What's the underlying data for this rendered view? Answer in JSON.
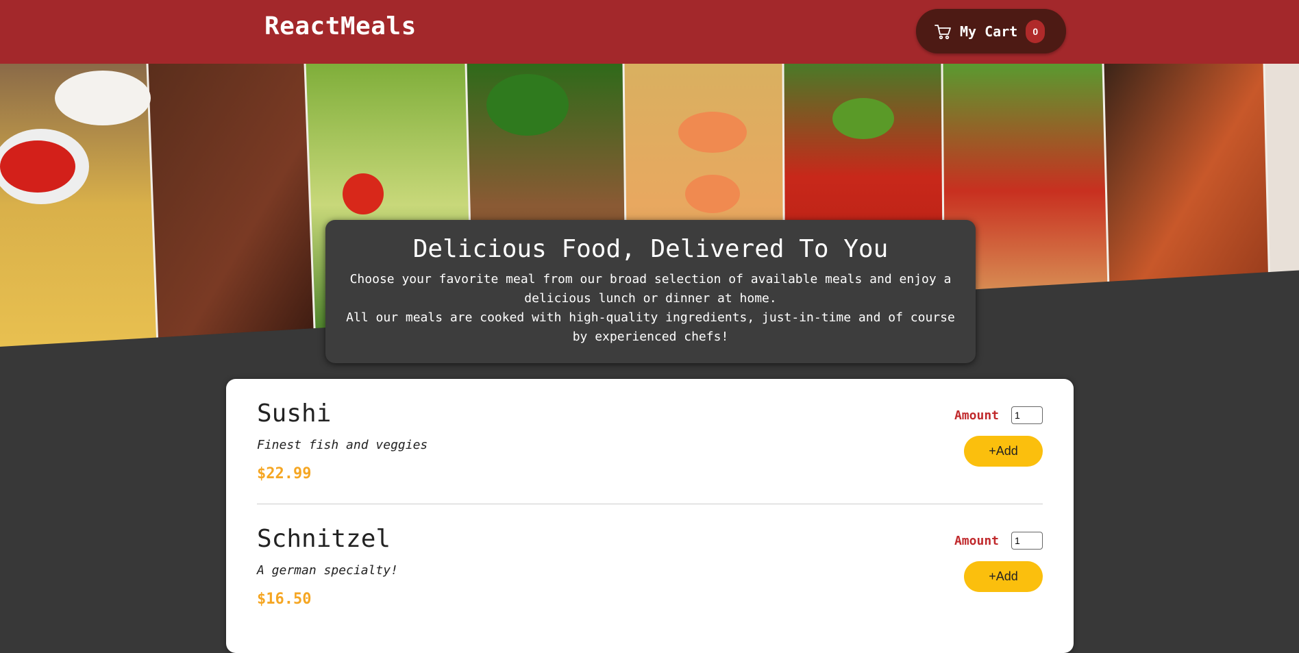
{
  "header": {
    "logo": "ReactMeals",
    "cart_label": "My Cart",
    "cart_count": "0",
    "cart_icon": "cart-icon"
  },
  "summary": {
    "title": "Delicious Food, Delivered To You",
    "paragraph1": "Choose your favorite meal from our broad selection of available meals and enjoy a delicious lunch or dinner at home.",
    "paragraph2": "All our meals are cooked with high-quality ingredients, just-in-time and of course by experienced chefs!"
  },
  "meals": [
    {
      "name": "Sushi",
      "description": "Finest fish and veggies",
      "price": "$22.99",
      "amount_label": "Amount",
      "amount_value": "1",
      "add_label": "+Add"
    },
    {
      "name": "Schnitzel",
      "description": "A german specialty!",
      "price": "$16.50",
      "amount_label": "Amount",
      "amount_value": "1",
      "add_label": "+Add"
    }
  ],
  "colors": {
    "header_bg": "#a3282b",
    "cart_button_bg": "#4d1a14",
    "page_bg": "#383838",
    "price": "#f5a623",
    "amount_label": "#c0292c",
    "add_button": "#fbbf0d"
  }
}
